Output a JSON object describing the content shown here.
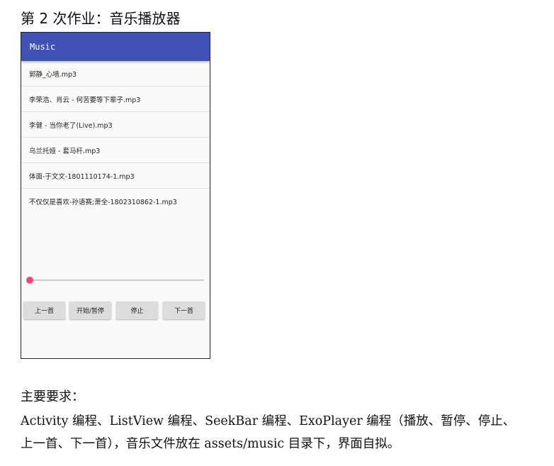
{
  "heading": "第 2 次作业：音乐播放器",
  "app": {
    "title": "Music",
    "accent_color": "#3f51b5",
    "seek_color": "#ff4081",
    "songs": [
      "郭静_心墙.mp3",
      "李荣浩、肖云 - 何苦要等下辈子.mp3",
      "李健 - 当你老了(Live).mp3",
      "乌兰托娅 - 套马杆.mp3",
      "体面-于文文-1801110174-1.mp3",
      "不仅仅是喜欢-孙语赛;萧全-1802310862-1.mp3"
    ],
    "seekbar": {
      "progress": 0
    },
    "buttons": {
      "prev": "上一首",
      "play_pause": "开始/暂停",
      "stop": "停止",
      "next": "下一首"
    }
  },
  "requirements": {
    "title": "主要要求：",
    "lines": [
      "Activity 编程、ListView 编程、SeekBar 编程、ExoPlayer 编程（播放、暂停、停止、",
      "上一首、下一首），音乐文件放在 assets/music 目录下，界面自拟。"
    ]
  }
}
